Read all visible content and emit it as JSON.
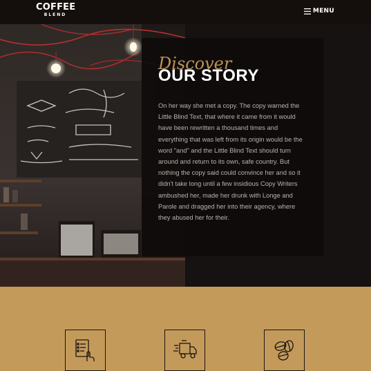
{
  "brand": {
    "line1": "COFFEE",
    "line2": "BLEND"
  },
  "nav": {
    "menu_label": "MENU",
    "menu_icon": "hamburger-icon"
  },
  "about": {
    "script_title": "Discover",
    "title": "OUR STORY",
    "body": "On her way she met a copy. The copy warned the Little Blind Text, that where it came from it would have been rewritten a thousand times and everything that was left from its origin would be the word \"and\" and the Little Blind Text should turn around and return to its own, safe country. But nothing the copy said could convince her and so it didn't take long until a few insidious Copy Writers ambushed her, made her drunk with Longe and Parole and dragged her into their agency, where they abused her for their."
  },
  "services": {
    "items": [
      {
        "icon": "checklist-order-icon"
      },
      {
        "icon": "delivery-truck-icon"
      },
      {
        "icon": "coffee-beans-icon"
      }
    ]
  },
  "colors": {
    "accent": "#c49a5b",
    "topbar": "#140f0d",
    "dark": "#0f0c0b"
  }
}
